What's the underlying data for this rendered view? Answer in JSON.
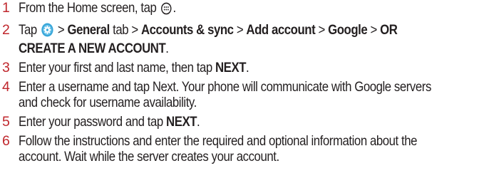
{
  "steps": [
    {
      "num": "1",
      "pre": "From the Home screen, tap ",
      "post": "."
    },
    {
      "num": "2",
      "tap": "Tap ",
      "gt1": " > ",
      "general": "General",
      "tab": " tab > ",
      "accounts": "Accounts & sync",
      "gt2": " > ",
      "add": "Add account",
      "gt3": " > ",
      "google": "Google",
      "gt4": " > ",
      "or": "OR",
      "create": "CREATE A NEW ACCOUNT",
      "post": "."
    },
    {
      "num": "3",
      "pre": "Enter your first and last name, then tap ",
      "next": "NEXT",
      "post": "."
    },
    {
      "num": "4",
      "line1": "Enter a username and tap Next. Your phone will communicate with Google servers",
      "line2": "and check for username availability."
    },
    {
      "num": "5",
      "pre": "Enter your password and tap ",
      "next": "NEXT",
      "post": "."
    },
    {
      "num": "6",
      "line1": "Follow the instructions and enter the required and optional information about the",
      "line2": "account. Wait while the server creates your account."
    }
  ],
  "icons": {
    "apps": "apps-icon",
    "settings": "settings-icon"
  },
  "colors": {
    "step_number": "#c0272d",
    "text": "#231f20",
    "settings_icon_bg": "#3aa7d9"
  }
}
